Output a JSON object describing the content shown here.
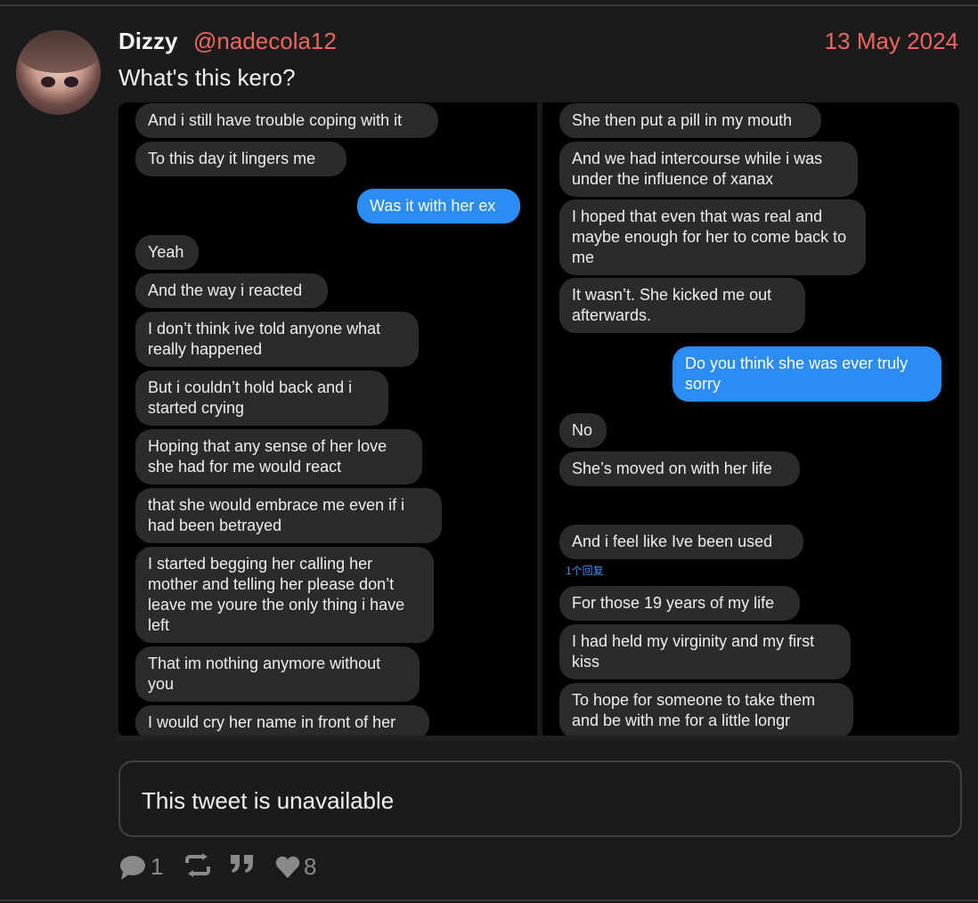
{
  "post": {
    "author_name": "Dizzy",
    "author_handle": "@nadecola12",
    "date": "13 May 2024",
    "text": "What's this kero?"
  },
  "screenshot": {
    "left_messages": [
      {
        "text": "And i still have trouble coping with it",
        "side": "in"
      },
      {
        "text": "To this day it lingers me",
        "side": "in"
      },
      {
        "text": "Was it with her ex",
        "side": "out"
      },
      {
        "text": "Yeah",
        "side": "in"
      },
      {
        "text": "And the way i reacted",
        "side": "in"
      },
      {
        "text": "I don’t think ive told anyone what really happened",
        "side": "in"
      },
      {
        "text": "But i couldn’t hold back and i started crying",
        "side": "in"
      },
      {
        "text": "Hoping that any sense of her love she had for me would react",
        "side": "in"
      },
      {
        "text": "that she would embrace me even if i had been betrayed",
        "side": "in"
      },
      {
        "text": "I started begging her calling her mother and telling her please don’t leave me youre the only thing i have left",
        "side": "in"
      },
      {
        "text": "That im nothing anymore without you",
        "side": "in"
      },
      {
        "text": "I would cry her name in front of her",
        "side": "in"
      }
    ],
    "right_messages": [
      {
        "text": "She then put a pill in my mouth",
        "side": "in"
      },
      {
        "text": "And we had intercourse while i was under the influence of xanax",
        "side": "in"
      },
      {
        "text": "I hoped that even that was real and maybe enough for her to come back to me",
        "side": "in"
      },
      {
        "text": "It wasn’t. She kicked me out afterwards.",
        "side": "in"
      },
      {
        "text": "Do you think she was ever truly sorry",
        "side": "out"
      },
      {
        "text": "No",
        "side": "in"
      },
      {
        "text": "She’s moved on with her life",
        "side": "in"
      },
      {
        "text": "And i feel like Ive been used",
        "side": "in"
      },
      {
        "text": "For those 19 years of my life",
        "side": "in"
      },
      {
        "text": "I had held my virginity and my first kiss",
        "side": "in"
      },
      {
        "text": "To hope for someone to take them and be with me for a little longr",
        "side": "in"
      }
    ],
    "reply_link": "1个回复"
  },
  "quoted": {
    "text": "This tweet is unavailable"
  },
  "actions": {
    "reply_count": "1",
    "like_count": "8"
  },
  "colors": {
    "accent": "#f0665e",
    "background": "#1b1b1b",
    "outgoing_bubble": "#2a8cf4",
    "incoming_bubble": "#2b2b2e"
  },
  "icons": [
    "reply-icon",
    "retweet-icon",
    "quote-icon",
    "like-icon"
  ]
}
